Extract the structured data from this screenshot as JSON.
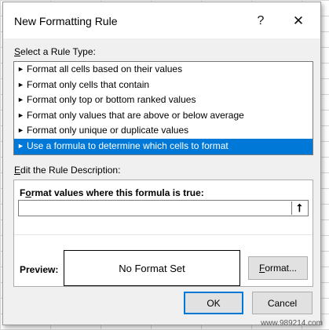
{
  "dialog": {
    "title": "New Formatting Rule",
    "help_glyph": "?",
    "close_glyph": "✕"
  },
  "rule_type": {
    "label_u": "S",
    "label_rest": "elect a Rule Type:",
    "arrow_glyph": "►",
    "items": [
      {
        "label": "Format all cells based on their values",
        "selected": false
      },
      {
        "label": "Format only cells that contain",
        "selected": false
      },
      {
        "label": "Format only top or bottom ranked values",
        "selected": false
      },
      {
        "label": "Format only values that are above or below average",
        "selected": false
      },
      {
        "label": "Format only unique or duplicate values",
        "selected": false
      },
      {
        "label": "Use a formula to determine which cells to format",
        "selected": true
      }
    ]
  },
  "description": {
    "label_u": "E",
    "label_rest": "dit the Rule Description:",
    "formula_title_pre": "F",
    "formula_title_u": "o",
    "formula_title_rest": "rmat values where this formula is true:",
    "formula_value": "",
    "collapse_glyph": "⭡",
    "preview_label": "Preview:",
    "preview_text": "No Format Set",
    "format_button_pre": "",
    "format_button_u": "F",
    "format_button_rest": "ormat..."
  },
  "buttons": {
    "ok": "OK",
    "cancel": "Cancel"
  },
  "watermark": "www.989214.com",
  "colors": {
    "selection": "#0078d7",
    "dialog_bg": "#f0f0f0"
  }
}
